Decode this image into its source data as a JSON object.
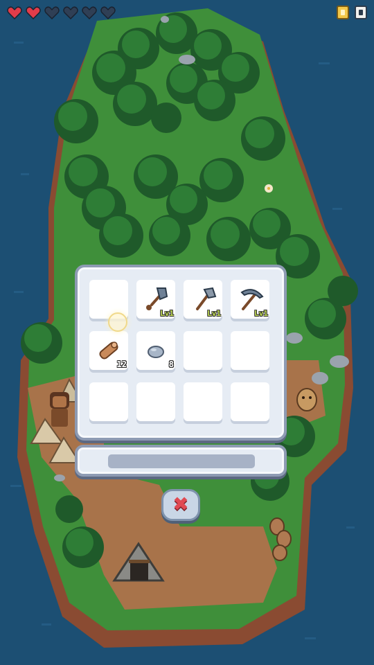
{
  "hud": {
    "hearts": [
      "full",
      "full",
      "empty",
      "empty",
      "empty",
      "empty"
    ],
    "heart_full_color": "#e23c4a",
    "heart_empty_color": "#2f3f55",
    "buttons": [
      "gold-card-icon",
      "map-icon"
    ]
  },
  "inventory": {
    "slots": [
      {
        "item": "",
        "icon": ""
      },
      {
        "item": "shovel",
        "icon": "shovel-icon",
        "level": "Lv1"
      },
      {
        "item": "axe",
        "icon": "axe-icon",
        "level": "Lv1"
      },
      {
        "item": "pickaxe",
        "icon": "pickaxe-icon",
        "level": "Lv1"
      },
      {
        "item": "wood",
        "icon": "wood-log-icon",
        "count": "12"
      },
      {
        "item": "stone",
        "icon": "stone-icon",
        "count": "8"
      },
      {
        "item": "",
        "icon": ""
      },
      {
        "item": "",
        "icon": ""
      },
      {
        "item": "",
        "icon": ""
      },
      {
        "item": "",
        "icon": ""
      },
      {
        "item": "",
        "icon": ""
      },
      {
        "item": "",
        "icon": ""
      }
    ]
  },
  "close_button": {
    "icon": "close-icon",
    "label": "✖"
  },
  "colors": {
    "water": "#1c4f73",
    "grass": "#3f8f3a",
    "dirt": "#a8734a",
    "panel": "#e6ecf4"
  }
}
